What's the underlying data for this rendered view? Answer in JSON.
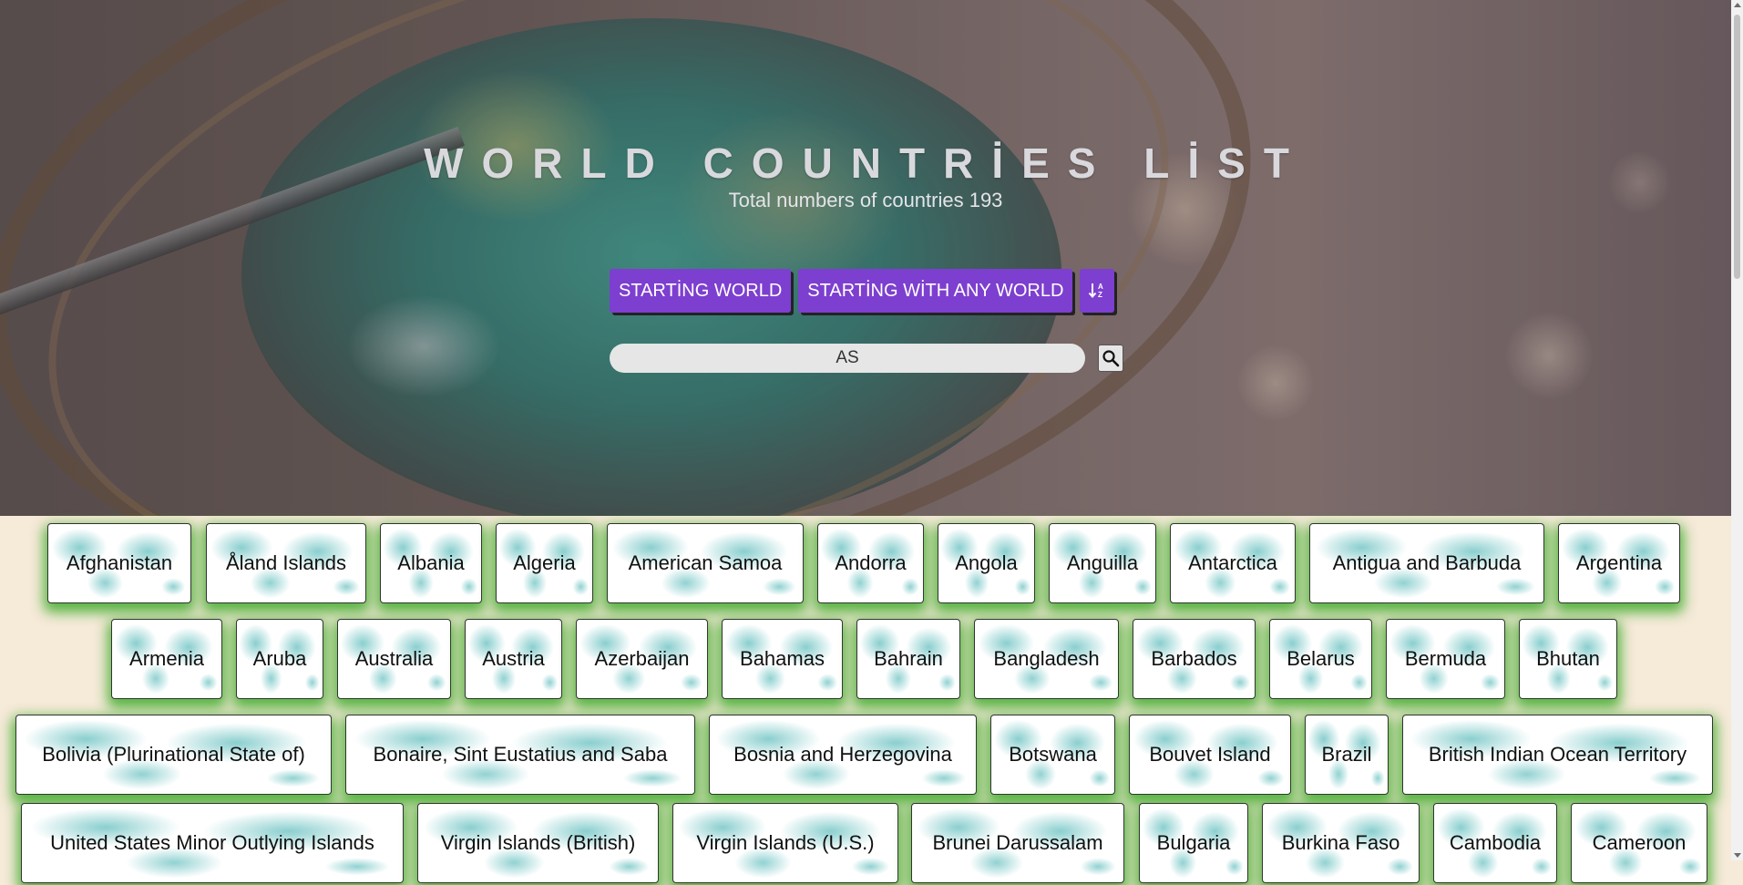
{
  "header": {
    "title": "WORLD COUNTRİES LİST",
    "subtitle": "Total numbers of countries 193"
  },
  "buttons": {
    "starting_word": "STARTİNG WORLD",
    "starting_with_any_word": "STARTİNG WİTH ANY WORLD",
    "sort_icon": "sort-alpha-down-icon"
  },
  "search": {
    "value": "AS",
    "icon": "search-icon"
  },
  "colors": {
    "accent": "#7d3fcf",
    "card_glow": "#3caa28",
    "page_background": "#f6ead9"
  },
  "countries": [
    [
      "Afghanistan",
      "Åland Islands",
      "Albania",
      "Algeria",
      "American Samoa",
      "Andorra",
      "Angola",
      "Anguilla",
      "Antarctica",
      "Antigua and Barbuda",
      "Argentina"
    ],
    [
      "Armenia",
      "Aruba",
      "Australia",
      "Austria",
      "Azerbaijan",
      "Bahamas",
      "Bahrain",
      "Bangladesh",
      "Barbados",
      "Belarus",
      "Bermuda",
      "Bhutan"
    ],
    [
      "Bolivia (Plurinational State of)",
      "Bonaire, Sint Eustatius and Saba",
      "Bosnia and Herzegovina",
      "Botswana",
      "Bouvet Island",
      "Brazil",
      "British Indian Ocean Territory"
    ],
    [
      "United States Minor Outlying Islands",
      "Virgin Islands (British)",
      "Virgin Islands (U.S.)",
      "Brunei Darussalam",
      "Bulgaria",
      "Burkina Faso",
      "Cambodia",
      "Cameroon"
    ]
  ]
}
